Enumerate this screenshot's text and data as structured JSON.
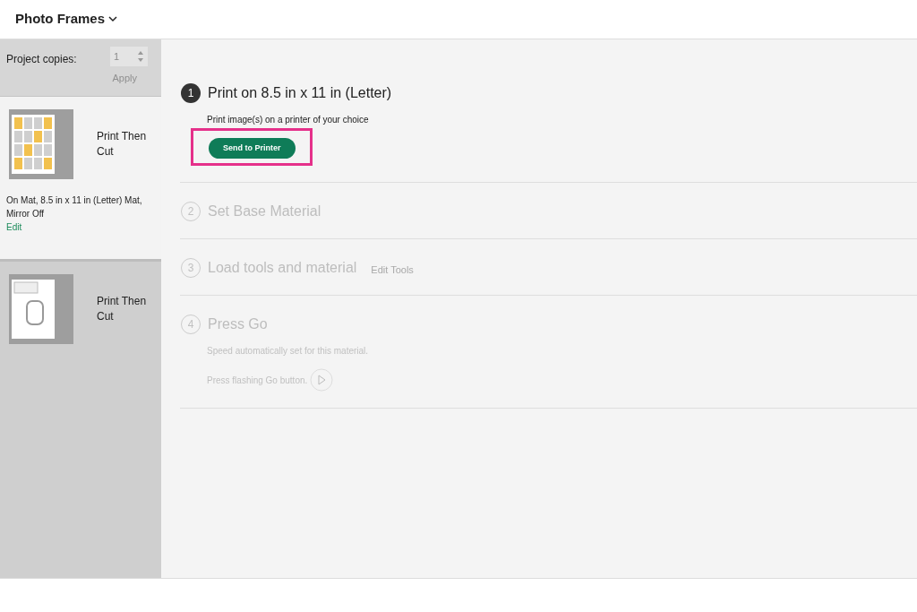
{
  "header": {
    "title": "Photo Frames"
  },
  "copies": {
    "label": "Project copies:",
    "value": "1",
    "apply": "Apply"
  },
  "mats": [
    {
      "label": "Print Then Cut",
      "selected": true,
      "details": "On Mat, 8.5 in x 11 in (Letter) Mat, Mirror Off",
      "edit": "Edit"
    },
    {
      "label": "Print Then Cut",
      "selected": false
    }
  ],
  "steps": [
    {
      "number": "1",
      "title": "Print on 8.5 in x 11 in (Letter)",
      "active": true,
      "description": "Print image(s) on a printer of your choice",
      "button": "Send to Printer",
      "highlighted": true
    },
    {
      "number": "2",
      "title": "Set Base Material",
      "active": false
    },
    {
      "number": "3",
      "title": "Load tools and material",
      "active": false,
      "link": "Edit Tools"
    },
    {
      "number": "4",
      "title": "Press Go",
      "active": false,
      "description": "Speed automatically set for this material.",
      "go_text": "Press flashing Go button."
    }
  ]
}
